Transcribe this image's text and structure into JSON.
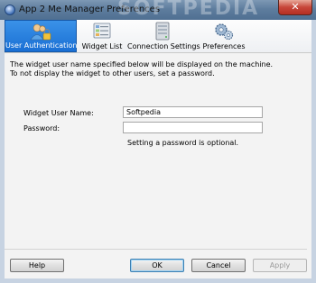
{
  "window": {
    "title": "App 2 Me Manager Preferences",
    "close_label": "✕",
    "watermark": "SOFTPEDIA"
  },
  "tabs": [
    {
      "label": "User Authentication",
      "icon": "users-lock-icon",
      "active": true
    },
    {
      "label": "Widget List",
      "icon": "widget-list-icon",
      "active": false
    },
    {
      "label": "Connection Settings",
      "icon": "server-icon",
      "active": false
    },
    {
      "label": "Preferences",
      "icon": "gears-icon",
      "active": false
    }
  ],
  "panel": {
    "description_line1": "The widget user name specified below will be displayed on the machine.",
    "description_line2": "To not display the widget to other users, set a password.",
    "username_label": "Widget User Name:",
    "username_value": "Softpedia",
    "password_label": "Password:",
    "password_value": "",
    "password_hint": "Setting a password is optional."
  },
  "buttons": {
    "help": "Help",
    "ok": "OK",
    "cancel": "Cancel",
    "apply": "Apply"
  },
  "colors": {
    "active_tab": "#1f78dc",
    "titlebar": "#5e7d9e",
    "close_button": "#c7473a"
  }
}
